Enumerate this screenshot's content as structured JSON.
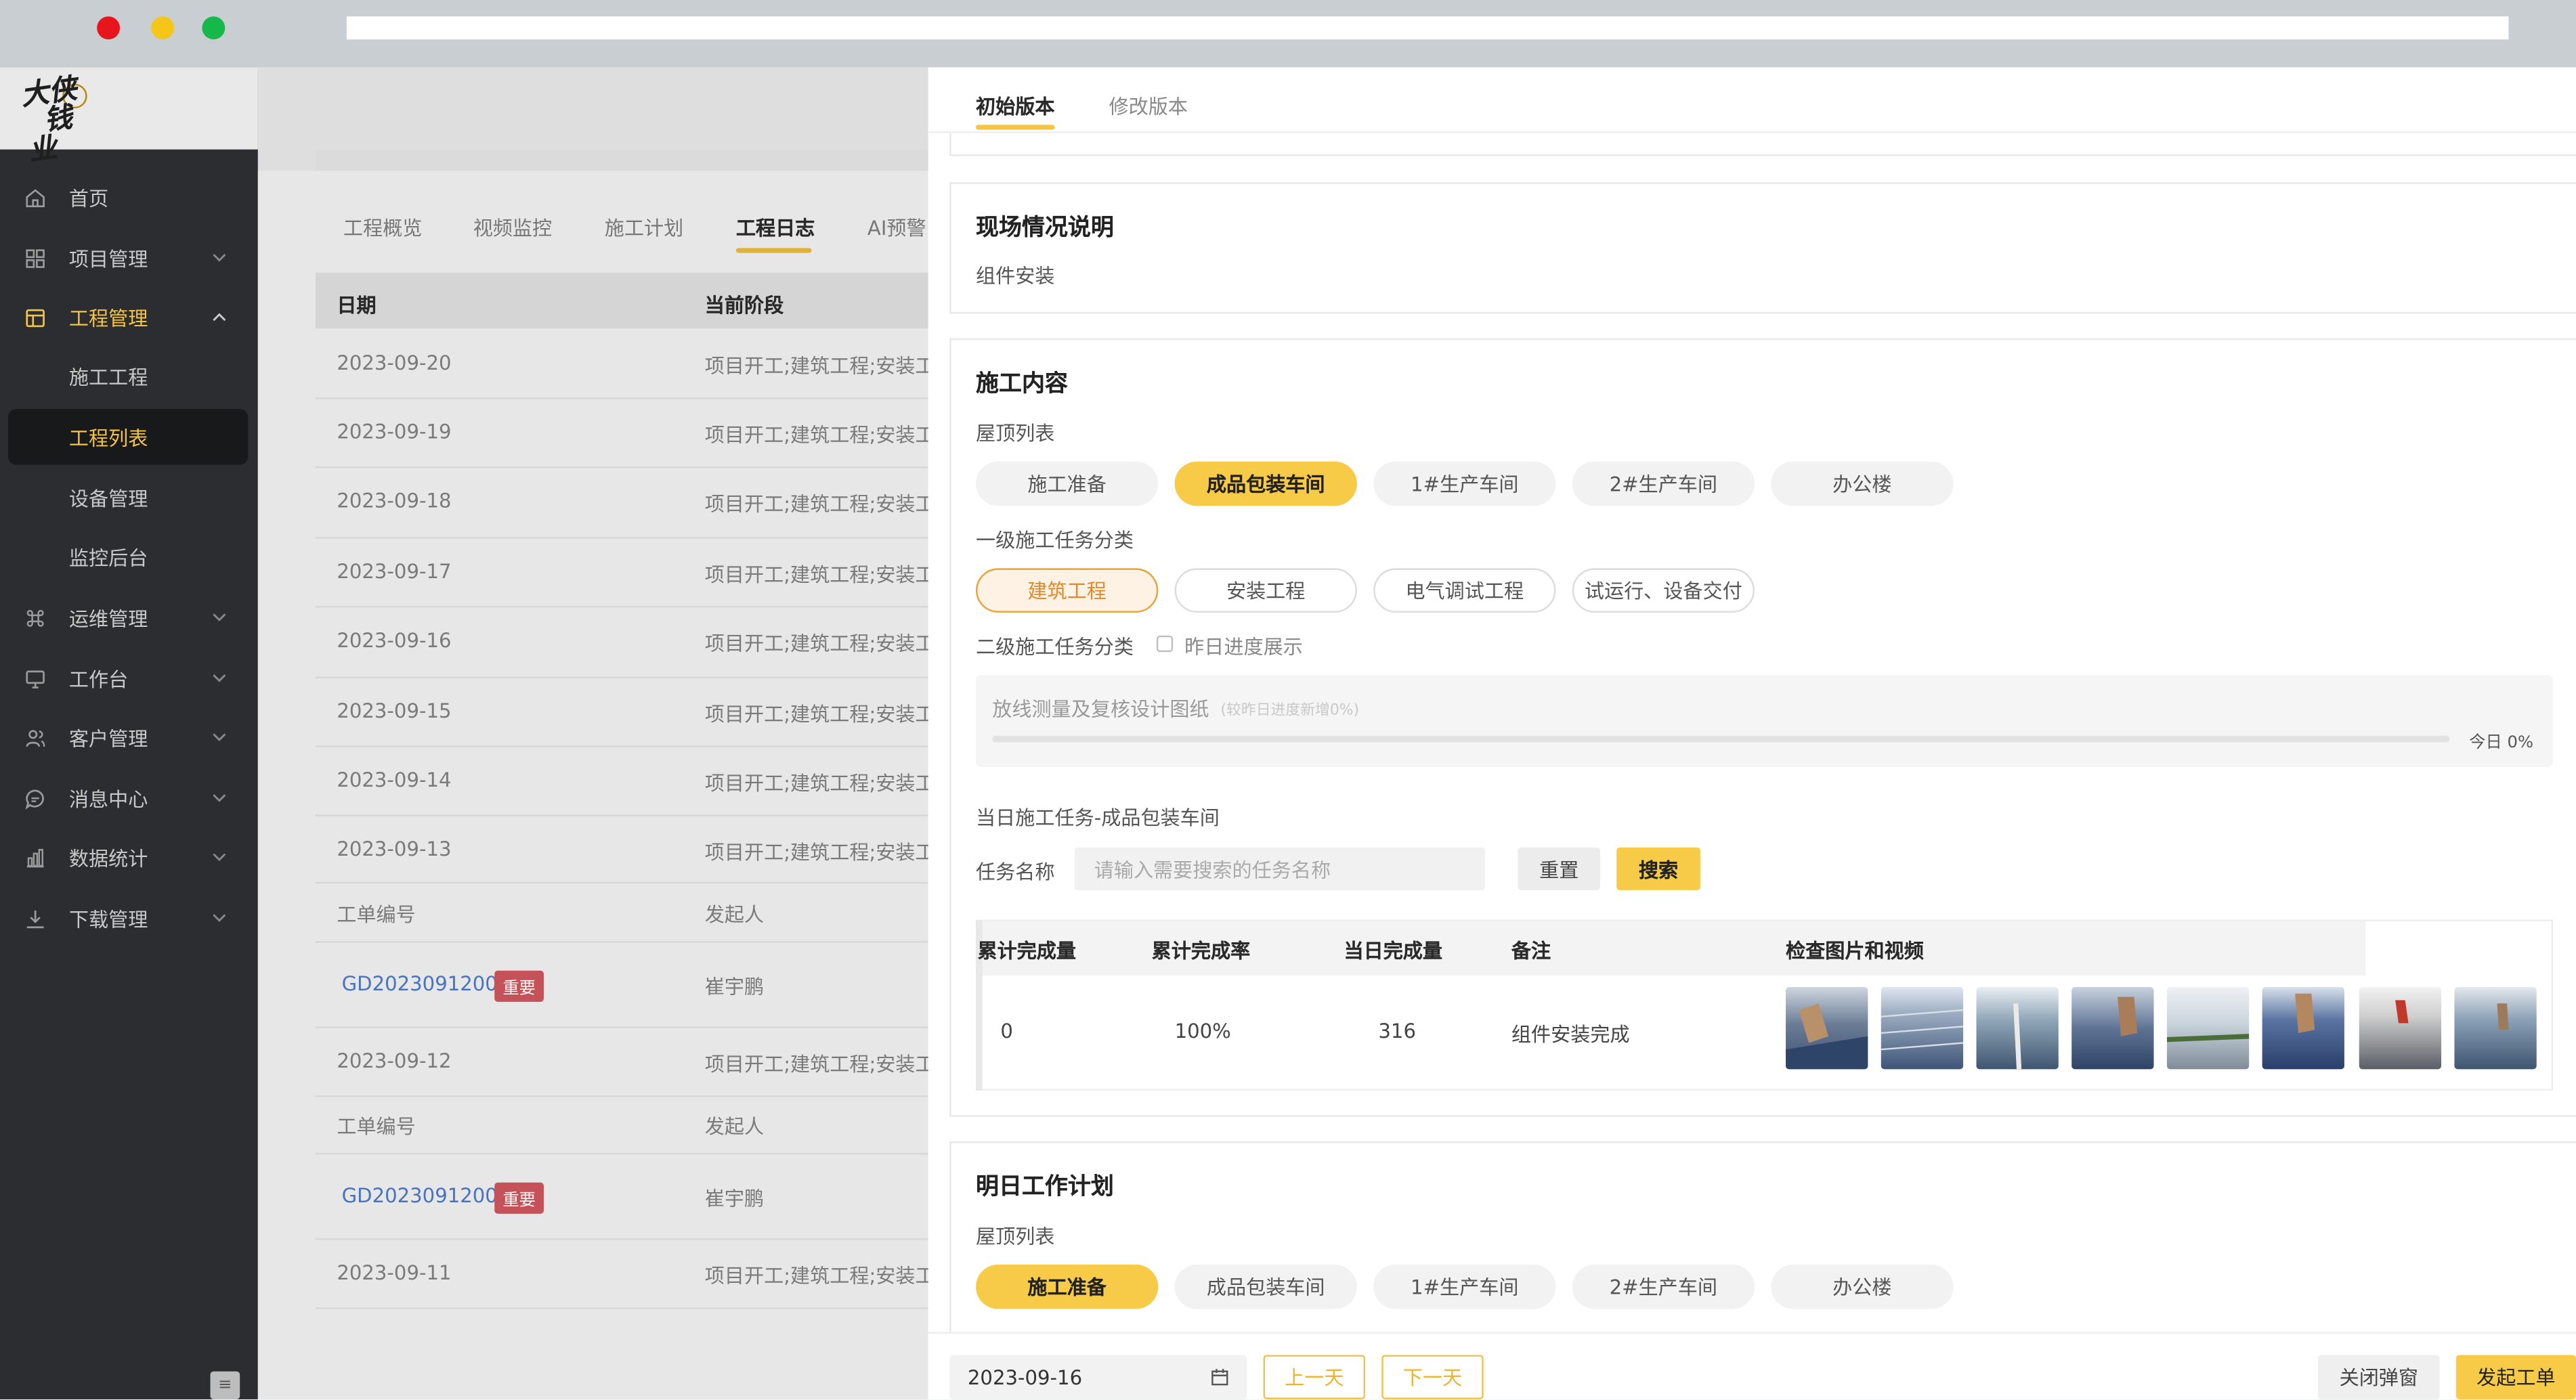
{
  "colors": {
    "accent": "#f7cb47",
    "sidebar_bg": "#2b2d30",
    "link": "#4a76c4",
    "tag_important": "#c9545a"
  },
  "sidebar": {
    "items": [
      {
        "label": "首页",
        "icon": "home-icon"
      },
      {
        "label": "项目管理",
        "icon": "grid-icon"
      },
      {
        "label": "工程管理",
        "icon": "building-icon"
      },
      {
        "label": "施工工程"
      },
      {
        "label": "工程列表"
      },
      {
        "label": "设备管理"
      },
      {
        "label": "监控后台"
      },
      {
        "label": "运维管理",
        "icon": "command-icon"
      },
      {
        "label": "工作台",
        "icon": "monitor-icon"
      },
      {
        "label": "客户管理",
        "icon": "users-icon"
      },
      {
        "label": "消息中心",
        "icon": "message-icon"
      },
      {
        "label": "数据统计",
        "icon": "bar-chart-icon"
      },
      {
        "label": "下载管理",
        "icon": "download-icon"
      }
    ]
  },
  "main": {
    "tabs": [
      "工程概览",
      "视频监控",
      "施工计划",
      "工程日志",
      "AI预警"
    ],
    "columns": [
      "日期",
      "当前阶段"
    ],
    "rows": [
      {
        "date": "2023-09-20",
        "stage": "项目开工;建筑工程;安装工"
      },
      {
        "date": "2023-09-19",
        "stage": "项目开工;建筑工程;安装工"
      },
      {
        "date": "2023-09-18",
        "stage": "项目开工;建筑工程;安装工"
      },
      {
        "date": "2023-09-17",
        "stage": "项目开工;建筑工程;安装工"
      },
      {
        "date": "2023-09-16",
        "stage": "项目开工;建筑工程;安装工"
      },
      {
        "date": "2023-09-15",
        "stage": "项目开工;建筑工程;安装工"
      },
      {
        "date": "2023-09-14",
        "stage": "项目开工;建筑工程;安装工"
      },
      {
        "date": "2023-09-13",
        "stage": "项目开工;建筑工程;安装工"
      },
      {
        "date": "2023-09-12",
        "stage": "项目开工;建筑工程;安装工"
      },
      {
        "date": "2023-09-11",
        "stage": "项目开工;建筑工程;安装工"
      }
    ],
    "sub_header": {
      "col1": "工单编号",
      "col2": "发起人"
    },
    "work_orders": [
      {
        "id": "GD20230912001",
        "tag": "重要",
        "initiator": "崔宇鹏"
      },
      {
        "id": "GD20230912001",
        "tag": "重要",
        "initiator": "崔宇鹏"
      }
    ]
  },
  "drawer": {
    "tabs": [
      "初始版本",
      "修改版本"
    ],
    "site": {
      "title": "现场情况说明",
      "text": "组件安装"
    },
    "construction": {
      "title": "施工内容",
      "roof_label": "屋顶列表",
      "roofs": [
        "施工准备",
        "成品包装车间",
        "1#生产车间",
        "2#生产车间",
        "办公楼"
      ],
      "level1_label": "一级施工任务分类",
      "level1": [
        "建筑工程",
        "安装工程",
        "电气调试工程",
        "试运行、设备交付"
      ],
      "level2_label": "二级施工任务分类",
      "yesterday_label": "昨日进度展示",
      "progress": {
        "name": "放线测量及复核设计图纸",
        "note": "(较昨日进度新增0%)",
        "today": "今日 0%",
        "value": 0
      },
      "daily_title": "当日施工任务-成品包装车间",
      "task_name_label": "任务名称",
      "task_name_placeholder": "请输入需要搜索的任务名称",
      "reset_label": "重置",
      "search_label": "搜索",
      "table": {
        "headers": [
          "累计完成量",
          "累计完成率",
          "当日完成量",
          "备注",
          "检查图片和视频"
        ],
        "row": {
          "cum_qty": "0",
          "cum_rate": "100%",
          "day_qty": "316",
          "remark": "组件安装完成"
        }
      }
    },
    "tomorrow": {
      "title": "明日工作计划",
      "roof_label": "屋顶列表",
      "roofs": [
        "施工准备",
        "成品包装车间",
        "1#生产车间",
        "2#生产车间",
        "办公楼"
      ]
    },
    "footer": {
      "date": "2023-09-16",
      "prev": "上一天",
      "next": "下一天",
      "close": "关闭弹窗",
      "submit": "发起工单"
    }
  }
}
